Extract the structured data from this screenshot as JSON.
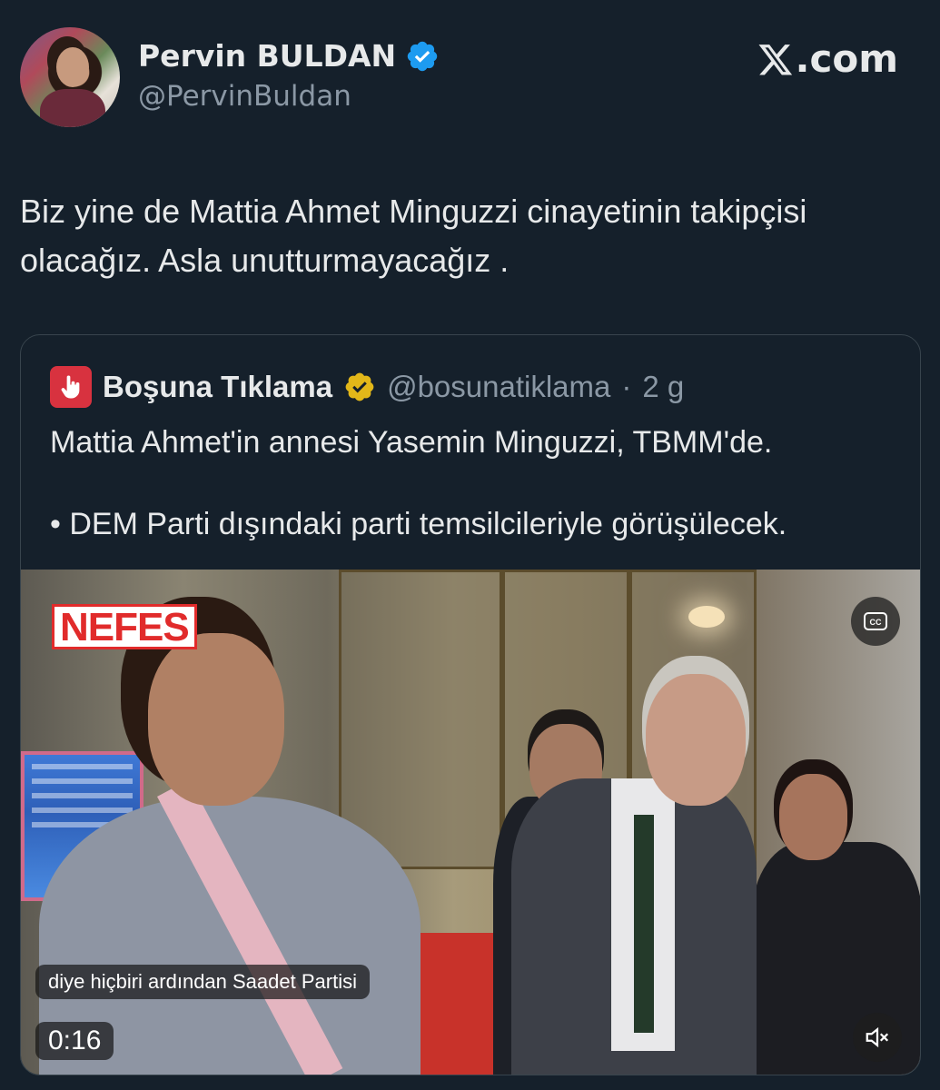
{
  "author": {
    "name": "Pervin BULDAN",
    "handle": "@PervinBuldan"
  },
  "brand": {
    "site": ".com"
  },
  "tweet": {
    "text": "Biz yine de Mattia Ahmet Minguzzi cinayetinin takipçisi olacağız. Asla unutturmayacağız ."
  },
  "quote": {
    "name": "Boşuna Tıklama",
    "handle": "@bosunatiklama",
    "separator": "·",
    "time": "2 g",
    "line1": "Mattia Ahmet'in annesi Yasemin Minguzzi, TBMM'de.",
    "line2": "• DEM Parti dışındaki parti temsilcileriyle görüşülecek."
  },
  "video": {
    "watermark": "NEFES",
    "caption": "diye hiçbiri ardından Saadet Partisi",
    "elapsed": "0:16",
    "cc_label": "CC"
  },
  "colors": {
    "background": "#15202b",
    "verified_blue": "#1d9bf0",
    "verified_gold": "#e2b719",
    "muted_text": "#8b98a5"
  },
  "icons": {
    "verified": "verified-badge-icon",
    "gold_verified": "gold-verified-badge-icon",
    "x_logo": "x-logo-icon",
    "cc": "closed-captions-icon",
    "mute": "muted-speaker-icon"
  }
}
